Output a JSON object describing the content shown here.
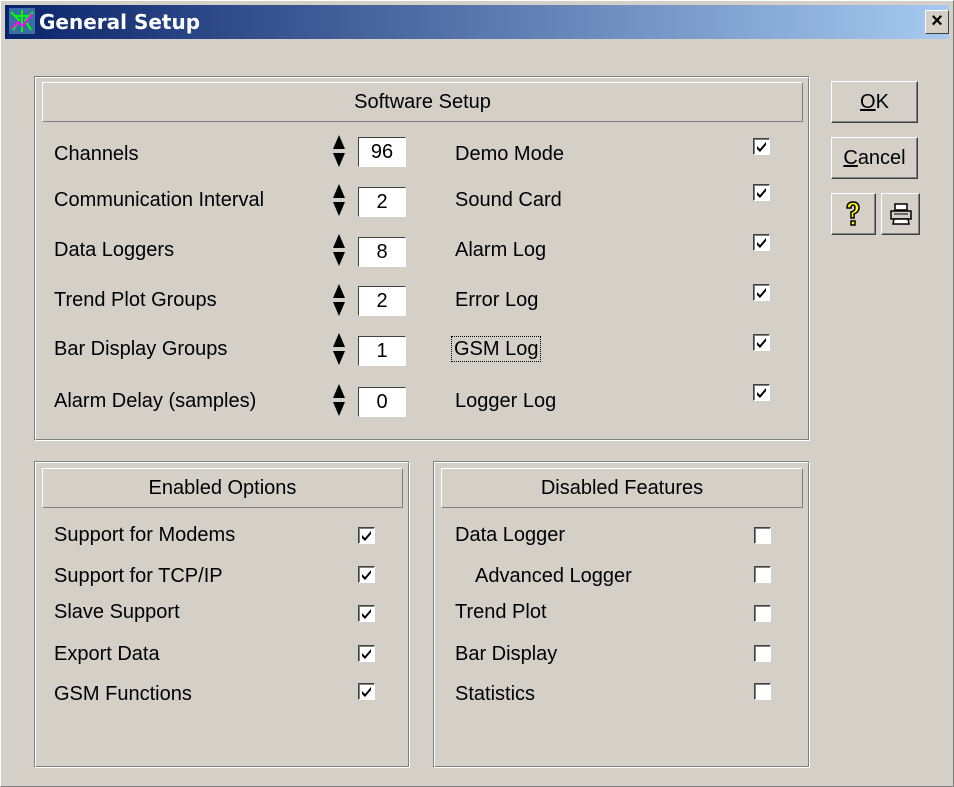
{
  "window": {
    "title": "General Setup",
    "close_glyph": "×"
  },
  "software_setup": {
    "header": "Software Setup",
    "spin_fields": [
      {
        "label": "Channels",
        "value": "96"
      },
      {
        "label": "Communication Interval",
        "value": "2"
      },
      {
        "label": "Data Loggers",
        "value": "8"
      },
      {
        "label": "Trend Plot Groups",
        "value": "2"
      },
      {
        "label": "Bar Display Groups",
        "value": "1"
      },
      {
        "label": "Alarm Delay (samples)",
        "value": "0"
      }
    ],
    "checkboxes": [
      {
        "label": "Demo Mode",
        "checked": true
      },
      {
        "label": "Sound Card",
        "checked": true
      },
      {
        "label": "Alarm Log",
        "checked": true
      },
      {
        "label": "Error Log",
        "checked": true
      },
      {
        "label": "GSM Log",
        "checked": true
      },
      {
        "label": "Logger Log",
        "checked": true
      }
    ]
  },
  "enabled_options": {
    "header": "Enabled Options",
    "items": [
      {
        "label": "Support for Modems",
        "checked": true
      },
      {
        "label": "Support for TCP/IP",
        "checked": true
      },
      {
        "label": "Slave Support",
        "checked": true
      },
      {
        "label": "Export Data",
        "checked": true
      },
      {
        "label": "GSM Functions",
        "checked": true
      }
    ]
  },
  "disabled_features": {
    "header": "Disabled Features",
    "items": [
      {
        "label": "Data Logger",
        "checked": false
      },
      {
        "label": "Advanced Logger",
        "checked": false
      },
      {
        "label": "Trend Plot",
        "checked": false
      },
      {
        "label": "Bar Display",
        "checked": false
      },
      {
        "label": "Statistics",
        "checked": false
      }
    ]
  },
  "buttons": {
    "ok_mnemonic": "O",
    "ok_rest": "K",
    "cancel_mnemonic": "C",
    "cancel_rest": "ancel",
    "help_icon": "question-icon",
    "print_icon": "printer-icon"
  },
  "colors": {
    "title_start": "#0a246a",
    "title_end": "#a6caf0",
    "face": "#d4d0c8",
    "help_yellow": "#ffff00"
  }
}
